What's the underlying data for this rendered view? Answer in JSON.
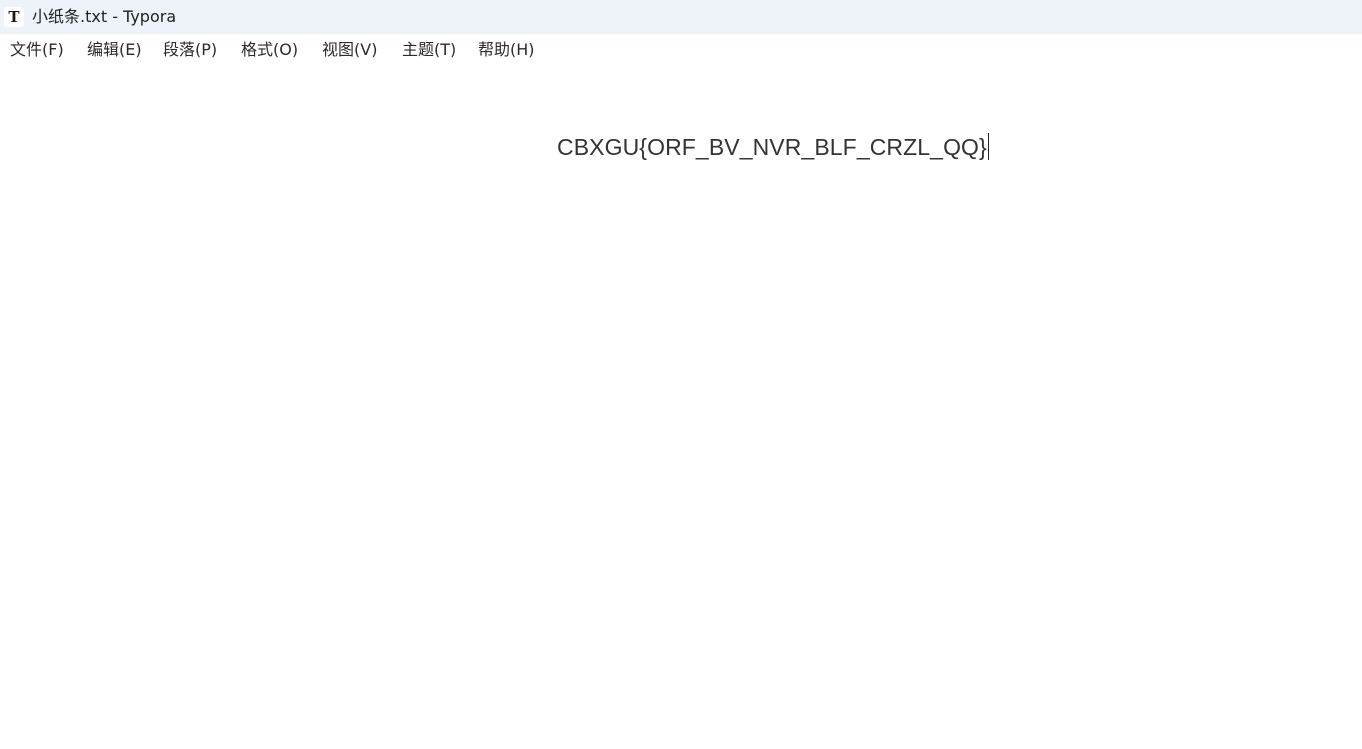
{
  "window": {
    "app_icon_glyph": "T",
    "title": "小纸条.txt - Typora"
  },
  "menu": {
    "items": [
      {
        "label": "文件(F)"
      },
      {
        "label": "编辑(E)"
      },
      {
        "label": "段落(P)"
      },
      {
        "label": "格式(O)"
      },
      {
        "label": "视图(V)"
      },
      {
        "label": "主题(T)"
      },
      {
        "label": "帮助(H)"
      }
    ]
  },
  "document": {
    "text": "CBXGU{ORF_BV_NVR_BLF_CRZL_QQ}"
  }
}
